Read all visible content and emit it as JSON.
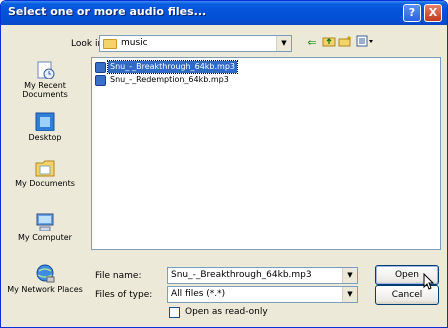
{
  "window": {
    "title": "Select one or more audio files...",
    "help_glyph": "?",
    "close_glyph": "X"
  },
  "lookin": {
    "label": "Look in:",
    "value": "music",
    "icon": "folder-icon"
  },
  "toolbar": {
    "back_glyph": "⇐",
    "up_glyph": "⮤",
    "newfolder_glyph": "✱",
    "views_glyph": "▦▾"
  },
  "places": [
    {
      "label": "My Recent Documents",
      "icon": "recent-documents-icon"
    },
    {
      "label": "Desktop",
      "icon": "desktop-icon"
    },
    {
      "label": "My Documents",
      "icon": "my-documents-icon"
    },
    {
      "label": "My Computer",
      "icon": "my-computer-icon"
    },
    {
      "label": "My Network Places",
      "icon": "network-places-icon"
    }
  ],
  "files": [
    {
      "name": "Snu_-_Breakthrough_64kb.mp3",
      "selected": true
    },
    {
      "name": "Snu_-_Redemption_64kb.mp3",
      "selected": false
    }
  ],
  "filename": {
    "label": "File name:",
    "value": "Snu_-_Breakthrough_64kb.mp3"
  },
  "filetype": {
    "label": "Files of type:",
    "value": "All files (*.*)"
  },
  "buttons": {
    "open": "Open",
    "cancel": "Cancel"
  },
  "readonly": {
    "label": "Open as read-only",
    "checked": false
  },
  "colors": {
    "titlebar": "#0453d9",
    "dialog_bg": "#ece9d8",
    "selection": "#316ac5"
  }
}
